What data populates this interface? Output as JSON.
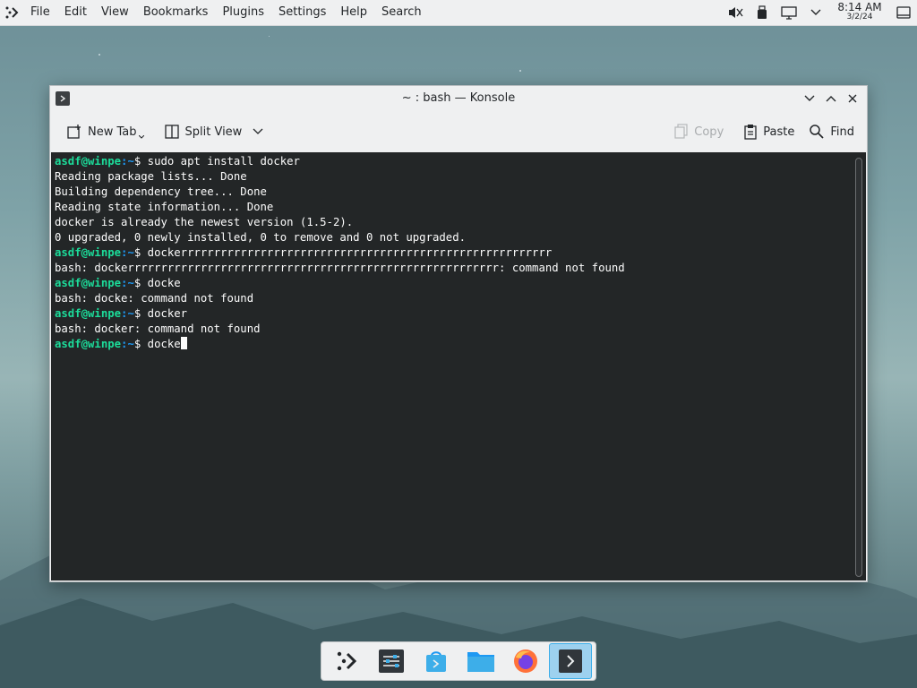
{
  "menubar": {
    "items": [
      "File",
      "Edit",
      "View",
      "Bookmarks",
      "Plugins",
      "Settings",
      "Help",
      "Search"
    ]
  },
  "tray": {
    "time": "8:14 AM",
    "date": "3/2/24",
    "icons": [
      "audio-muted-icon",
      "usb-drive-icon",
      "display-icon",
      "chevron-down-icon",
      "show-desktop-icon"
    ]
  },
  "window": {
    "title": "~ : bash — Konsole",
    "toolbar": {
      "new_tab": "New Tab",
      "split_view": "Split View",
      "copy": "Copy",
      "paste": "Paste",
      "find": "Find"
    }
  },
  "terminal": {
    "prompt": "asdf@winpe",
    "lines": [
      {
        "type": "cmd",
        "path": ":~",
        "text": "$ sudo apt install docker"
      },
      {
        "type": "out",
        "text": "Reading package lists... Done"
      },
      {
        "type": "out",
        "text": "Building dependency tree... Done"
      },
      {
        "type": "out",
        "text": "Reading state information... Done"
      },
      {
        "type": "out",
        "text": "docker is already the newest version (1.5-2)."
      },
      {
        "type": "out",
        "text": "0 upgraded, 0 newly installed, 0 to remove and 0 not upgraded."
      },
      {
        "type": "cmd",
        "path": ":~",
        "text": "$ dockerrrrrrrrrrrrrrrrrrrrrrrrrrrrrrrrrrrrrrrrrrrrrrrrrrrrrrrr"
      },
      {
        "type": "out",
        "text": "bash: dockerrrrrrrrrrrrrrrrrrrrrrrrrrrrrrrrrrrrrrrrrrrrrrrrrrrrrrrr: command not found"
      },
      {
        "type": "cmd",
        "path": ":~",
        "text": "$ docke"
      },
      {
        "type": "out",
        "text": "bash: docke: command not found"
      },
      {
        "type": "cmd",
        "path": ":~",
        "text": "$ docker"
      },
      {
        "type": "out",
        "text": "bash: docker: command not found"
      },
      {
        "type": "cmd",
        "path": ":~",
        "text": "$ docke",
        "cursor": true
      }
    ]
  },
  "taskbar": {
    "items": [
      "app-launcher-icon",
      "system-settings-icon",
      "discover-store-icon",
      "file-manager-icon",
      "firefox-icon",
      "konsole-icon"
    ],
    "active": "konsole-icon"
  },
  "colors": {
    "prompt": "#1cdc9a",
    "terminal_bg": "#232627",
    "accent": "#3daee9"
  }
}
